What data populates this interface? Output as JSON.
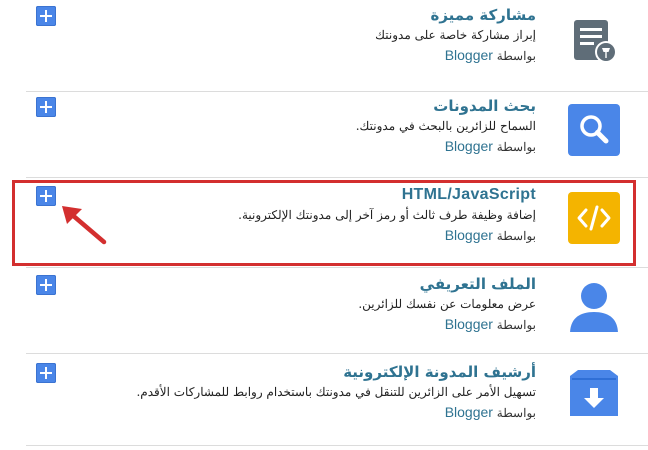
{
  "gadgets": [
    {
      "title": "مشاركة مميزة",
      "description": "إبراز مشاركة خاصة على مدونتك",
      "by_prefix": "بواسطة",
      "by_brand": "Blogger",
      "icon": "featured-post-icon"
    },
    {
      "title": "بحث المدونات",
      "description": "السماح للزائرين بالبحث في مدونتك.",
      "by_prefix": "بواسطة",
      "by_brand": "Blogger",
      "icon": "search-icon"
    },
    {
      "title": "HTML/JavaScript",
      "description": "إضافة وظيفة طرف ثالث أو رمز آخر إلى مدونتك الإلكترونية.",
      "by_prefix": "بواسطة",
      "by_brand": "Blogger",
      "icon": "code-icon"
    },
    {
      "title": "الملف التعريفي",
      "description": "عرض معلومات عن نفسك للزائرين.",
      "by_prefix": "بواسطة",
      "by_brand": "Blogger",
      "icon": "profile-icon"
    },
    {
      "title": "أرشيف المدونة الإلكترونية",
      "description": "تسهيل الأمر على الزائرين للتنقل في مدونتك باستخدام روابط للمشاركات الأقدم.",
      "by_prefix": "بواسطة",
      "by_brand": "Blogger",
      "icon": "archive-icon"
    }
  ],
  "colors": {
    "accent_blue": "#4a86e8",
    "title_teal": "#2f7391",
    "highlight_red": "#d32f2f",
    "code_yellow": "#f4b400",
    "icon_gray": "#5f6d78"
  }
}
